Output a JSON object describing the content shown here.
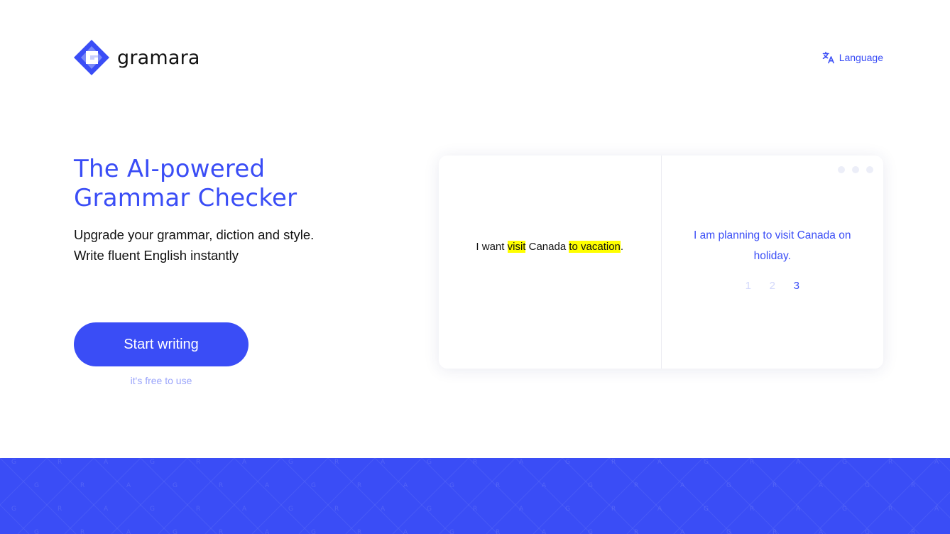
{
  "brand": {
    "name": "gramara",
    "logo_icon": "gramara-diamond-logo",
    "accent_color": "#3a4df6"
  },
  "nav": {
    "language_label": "Language",
    "language_icon": "translate-icon"
  },
  "hero": {
    "title_line1": "The AI-powered",
    "title_line2": "Grammar Checker",
    "subtitle_line1": "Upgrade your grammar, diction and style.",
    "subtitle_line2": "Write fluent English instantly",
    "cta_label": "Start writing",
    "cta_note": "it's free to use"
  },
  "demo": {
    "input_segments": [
      {
        "text": "I want ",
        "highlight": false
      },
      {
        "text": "visit",
        "highlight": true
      },
      {
        "text": " Canada ",
        "highlight": false
      },
      {
        "text": "to vacation",
        "highlight": true
      },
      {
        "text": ".",
        "highlight": false
      }
    ],
    "highlight_color": "#ffff00",
    "output_text": "I am planning to visit Canada on holiday.",
    "pages": [
      "1",
      "2",
      "3"
    ],
    "active_page": "3"
  },
  "footer": {
    "band_color": "#3a4df6",
    "pattern_letters": [
      "G",
      "R",
      "A"
    ]
  }
}
